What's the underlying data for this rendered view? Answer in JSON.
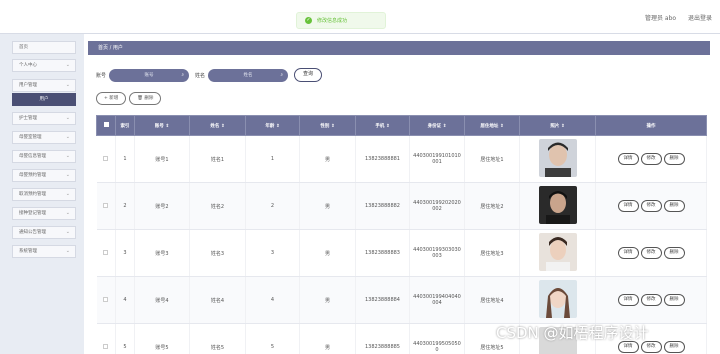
{
  "header": {
    "toast": "修改信息成功",
    "admin": "管理员 abo",
    "logout": "退出登录"
  },
  "sidebar": {
    "items": [
      {
        "label": "首页",
        "chev": ""
      },
      {
        "label": "个人中心",
        "chev": "⌄"
      },
      {
        "label": "用户管理",
        "chev": "⌄"
      },
      {
        "label": "用户",
        "chev": ""
      },
      {
        "label": "护士管理",
        "chev": "⌄"
      },
      {
        "label": "母婴室管理",
        "chev": "⌄"
      },
      {
        "label": "母婴信息管理",
        "chev": "⌄"
      },
      {
        "label": "母婴预约管理",
        "chev": "⌄"
      },
      {
        "label": "取消预约管理",
        "chev": "⌄"
      },
      {
        "label": "接种登记管理",
        "chev": "⌄"
      },
      {
        "label": "通知公告管理",
        "chev": "⌄"
      },
      {
        "label": "系统管理",
        "chev": "⌄"
      }
    ]
  },
  "breadcrumb": "首页 / 用户",
  "search": {
    "label1": "账号",
    "placeholder1": "账号",
    "label2": "姓名",
    "placeholder2": "姓名",
    "query": "查询"
  },
  "actions": {
    "add": "+ 新增",
    "delete": "删除"
  },
  "table": {
    "headers": [
      "",
      "索引",
      "账号 ⇕",
      "姓名 ⇕",
      "年龄 ⇕",
      "性别 ⇕",
      "手机 ⇕",
      "身份证 ⇕",
      "居住地址 ⇕",
      "照片 ⇕",
      "操作"
    ],
    "rows": [
      {
        "idx": "1",
        "account": "账号1",
        "name": "姓名1",
        "age": "1",
        "gender": "男",
        "phone": "13823888881",
        "idcard": "440300199101010001",
        "address": "居住地址1"
      },
      {
        "idx": "2",
        "account": "账号2",
        "name": "姓名2",
        "age": "2",
        "gender": "男",
        "phone": "13823888882",
        "idcard": "440300199202020002",
        "address": "居住地址2"
      },
      {
        "idx": "3",
        "account": "账号3",
        "name": "姓名3",
        "age": "3",
        "gender": "男",
        "phone": "13823888883",
        "idcard": "440300199303030003",
        "address": "居住地址3"
      },
      {
        "idx": "4",
        "account": "账号4",
        "name": "姓名4",
        "age": "4",
        "gender": "男",
        "phone": "13823888884",
        "idcard": "440300199404040004",
        "address": "居住地址4"
      },
      {
        "idx": "5",
        "account": "账号5",
        "name": "姓名5",
        "age": "5",
        "gender": "男",
        "phone": "13823888885",
        "idcard": "4403001995050500",
        "address": "居住地址5"
      }
    ],
    "ops": {
      "detail": "详情",
      "edit": "修改",
      "delete": "删除"
    }
  },
  "watermark": "CSDN @如梧程序设计",
  "colors": {
    "accent": "#6c7199",
    "dark": "#4a4f74",
    "success": "#67c23a"
  }
}
